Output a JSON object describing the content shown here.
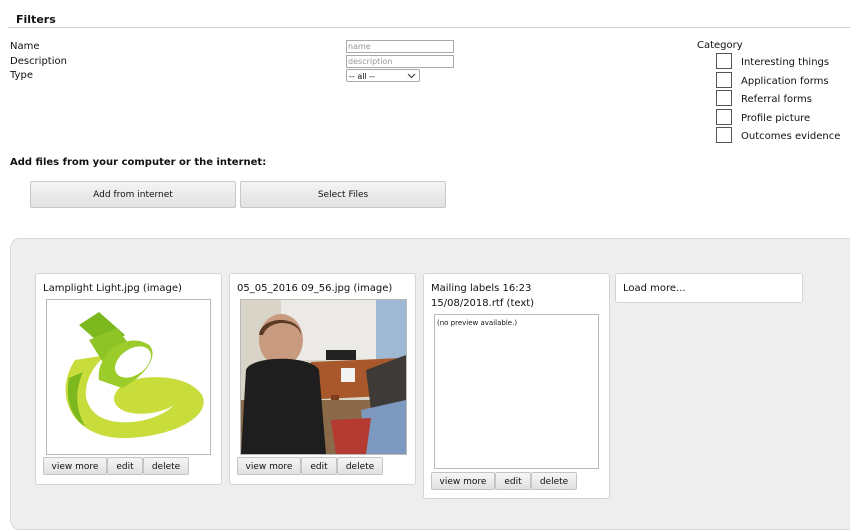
{
  "filters": {
    "title": "Filters",
    "name_label": "Name",
    "name_placeholder": "name",
    "description_label": "Description",
    "description_placeholder": "description",
    "type_label": "Type",
    "type_value": "-- all --"
  },
  "category": {
    "title": "Category",
    "items": [
      {
        "label": "Interesting things",
        "checked": false
      },
      {
        "label": "Application forms",
        "checked": false
      },
      {
        "label": "Referral forms",
        "checked": false
      },
      {
        "label": "Profile picture",
        "checked": false
      },
      {
        "label": "Outcomes evidence",
        "checked": false
      }
    ]
  },
  "add": {
    "title": "Add files from your computer or the internet:",
    "internet_button": "Add from internet",
    "select_button": "Select Files"
  },
  "files": [
    {
      "title": "Lamplight Light.jpg (image)",
      "preview": "lamplight-logo",
      "view": "view more",
      "edit": "edit",
      "delete": "delete"
    },
    {
      "title": "05_05_2016 09_56.jpg (image)",
      "preview": "photo-two-people-meeting",
      "view": "view more",
      "edit": "edit",
      "delete": "delete"
    },
    {
      "title_line1": "Mailing labels 16:23",
      "title_line2": "15/08/2018.rtf (text)",
      "preview_text": "(no preview available.)",
      "view": "view more",
      "edit": "edit",
      "delete": "delete"
    }
  ],
  "load_more": "Load more...",
  "colors": {
    "panel": "#eeeeee",
    "logo_light_green": "#c8dc3c",
    "logo_dark_green": "#7cb81e"
  }
}
